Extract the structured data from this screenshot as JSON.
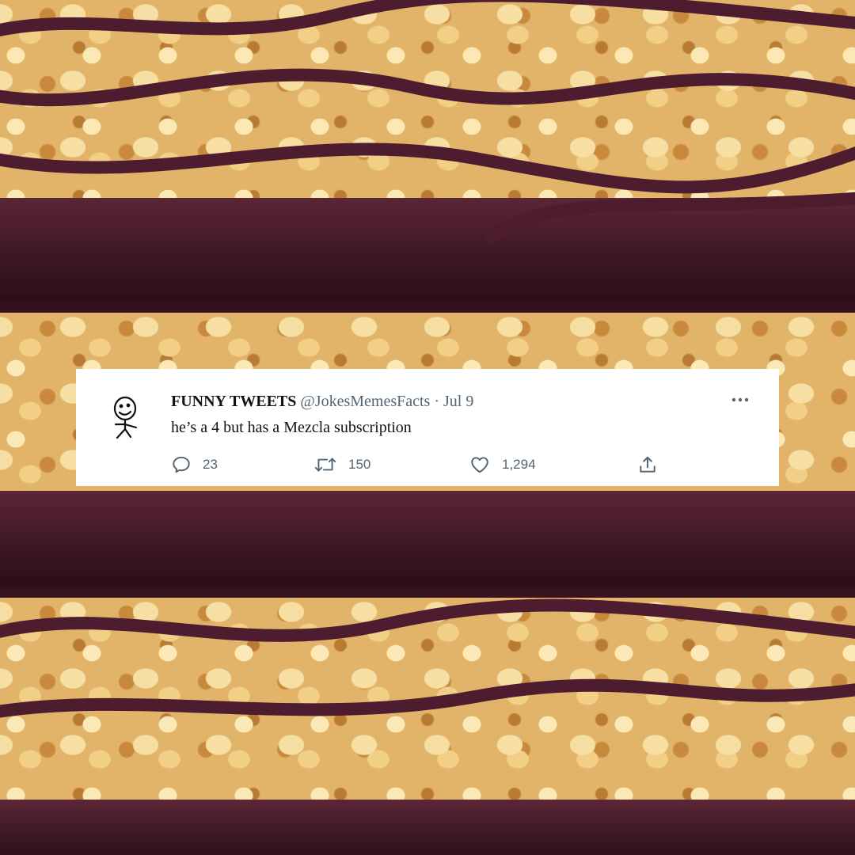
{
  "tweet": {
    "display_name": "FUNNY TWEETS",
    "handle": "@JokesMemesFacts",
    "separator": "·",
    "date": "Jul 9",
    "text": "he’s a 4 but has a Mezcla subscription",
    "more_icon": "more-horizontal-icon",
    "avatar_icon": "stick-figure-avatar"
  },
  "actions": {
    "reply": {
      "icon": "reply-icon",
      "count": "23"
    },
    "retweet": {
      "icon": "retweet-icon",
      "count": "150"
    },
    "like": {
      "icon": "heart-icon",
      "count": "1,294"
    },
    "share": {
      "icon": "share-icon"
    }
  },
  "colors": {
    "card_bg": "#ffffff",
    "text_primary": "#0f1419",
    "text_secondary": "#536471",
    "chocolate": "#4a1c2c",
    "crisp": "#e2b46a"
  }
}
